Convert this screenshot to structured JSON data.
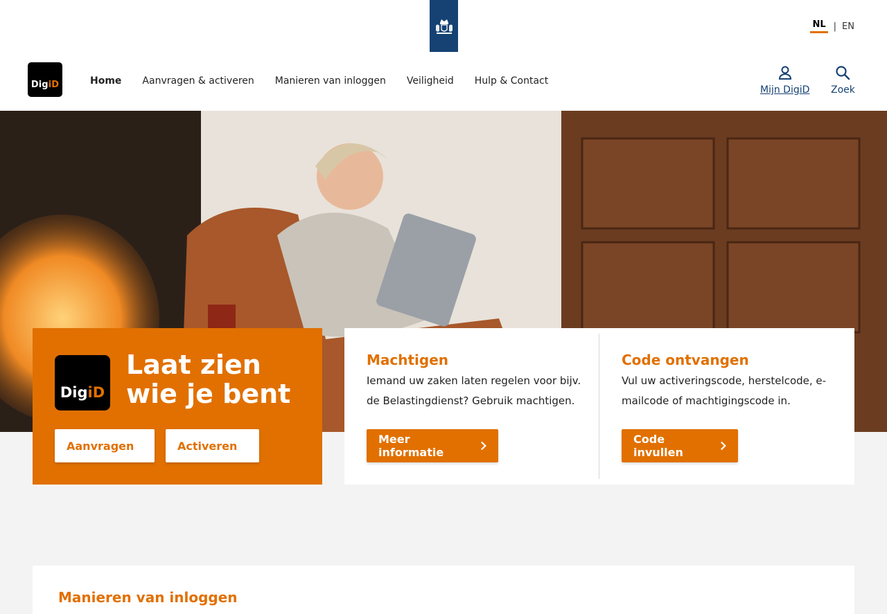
{
  "header": {
    "government_logo": "rijksoverheid-emblem",
    "language": {
      "active": "NL",
      "separator": "|",
      "other": "EN"
    },
    "logo_text": {
      "part1": "Dig",
      "part2": "iD"
    },
    "nav": [
      {
        "label": "Home",
        "active": true
      },
      {
        "label": "Aanvragen & activeren"
      },
      {
        "label": "Manieren van inloggen"
      },
      {
        "label": "Veiligheid"
      },
      {
        "label": "Hulp & Contact"
      }
    ],
    "mijn_digid": {
      "label": "Mijn DigiD",
      "icon": "user-icon"
    },
    "zoek": {
      "label": "Zoek",
      "icon": "search-icon"
    }
  },
  "hero": {
    "image": "woman-with-tablet-in-armchair-by-fireplace"
  },
  "intro_card": {
    "logo_text": {
      "part1": "Dig",
      "part2": "iD"
    },
    "title": "Laat zien wie je bent",
    "buttons": {
      "aanvragen": "Aanvragen",
      "activeren": "Activeren"
    }
  },
  "machtigen": {
    "title": "Machtigen",
    "text": "Iemand uw zaken laten regelen voor bijv. de Belastingdienst? Gebruik machtigen.",
    "button": "Meer informatie"
  },
  "code": {
    "title": "Code ontvangen",
    "text": "Vul uw activeringscode, herstelcode, e-mailcode of machtigingscode in.",
    "button": "Code invullen"
  },
  "section": {
    "title": "Manieren van inloggen"
  },
  "colors": {
    "brand_orange": "#e17000",
    "rijks_blue": "#154273",
    "background": "#f3f3f3"
  }
}
